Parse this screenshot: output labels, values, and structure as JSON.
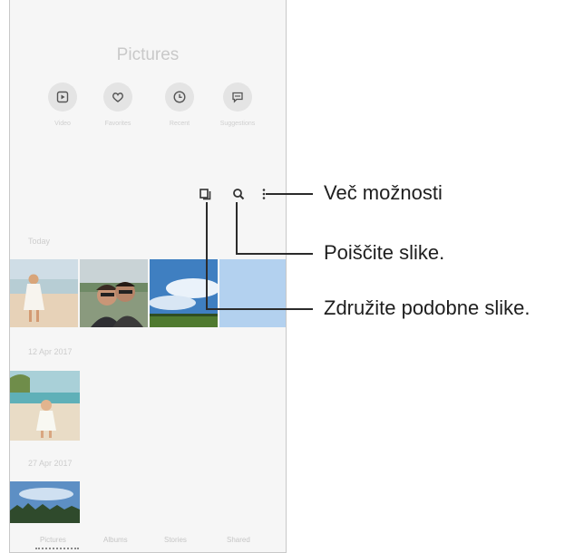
{
  "app": {
    "title": "Pictures"
  },
  "quick_actions": [
    {
      "label": "Video",
      "icon": "video-icon"
    },
    {
      "label": "Favorites",
      "icon": "heart-icon"
    },
    {
      "label": "Recent",
      "icon": "clock-icon"
    },
    {
      "label": "Suggestions",
      "icon": "suggestions-icon"
    }
  ],
  "toolbar": {
    "icons": [
      "group-similar-icon",
      "search-icon",
      "more-options-icon"
    ]
  },
  "sections": [
    {
      "date": "Today"
    },
    {
      "date": "12 Apr 2017"
    },
    {
      "date": "27 Apr 2017"
    }
  ],
  "bottom_tabs": [
    "Pictures",
    "Albums",
    "Stories",
    "Shared"
  ],
  "callouts": {
    "more_options": "Več možnosti",
    "search": "Poiščite slike.",
    "group_similar": "Združite podobne slike."
  }
}
